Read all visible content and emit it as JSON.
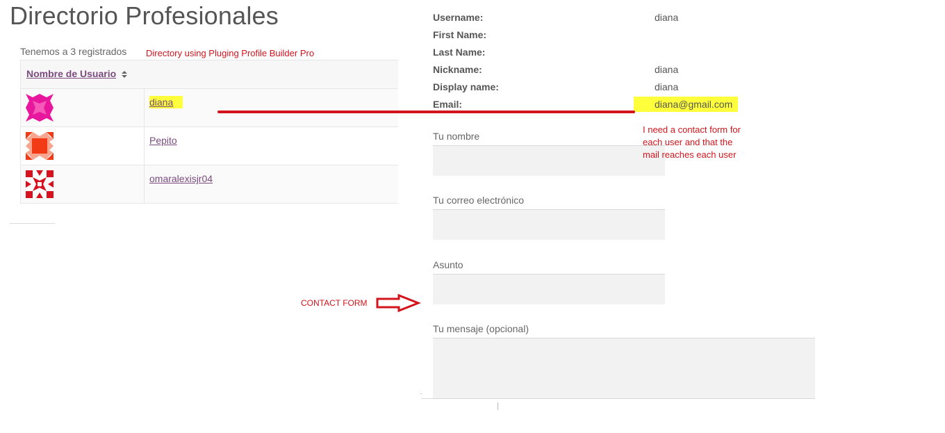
{
  "page": {
    "title": "Directorio Profesionales"
  },
  "directory": {
    "count_text": "Tenemos a 3 registrados",
    "column_header": "Nombre de Usuario",
    "rows": [
      {
        "username": "diana",
        "avatar_color": "#e8189e"
      },
      {
        "username": "Pepito",
        "avatar_color": "#f23a16"
      },
      {
        "username": "omaralexisjr04",
        "avatar_color": "#d7121e"
      }
    ]
  },
  "annotations": {
    "directory_note": "Directory using Pluging Profile Builder Pro",
    "contact_note": "I need a contact form for each user and that the mail reaches each user",
    "contact_form_label": "CONTACT FORM",
    "color": "#d3141c",
    "highlight_color": "#ffff3b"
  },
  "profile": {
    "fields": [
      {
        "label": "Username:",
        "value": "diana"
      },
      {
        "label": "First Name:",
        "value": ""
      },
      {
        "label": "Last Name:",
        "value": ""
      },
      {
        "label": "Nickname:",
        "value": "diana"
      },
      {
        "label": "Display name:",
        "value": "diana"
      },
      {
        "label": "Email:",
        "value": "diana@gmail.com"
      }
    ]
  },
  "contact_form": {
    "name_label": "Tu nombre",
    "email_label": "Tu correo electrónico",
    "subject_label": "Asunto",
    "message_label": "Tu mensaje (opcional)"
  }
}
